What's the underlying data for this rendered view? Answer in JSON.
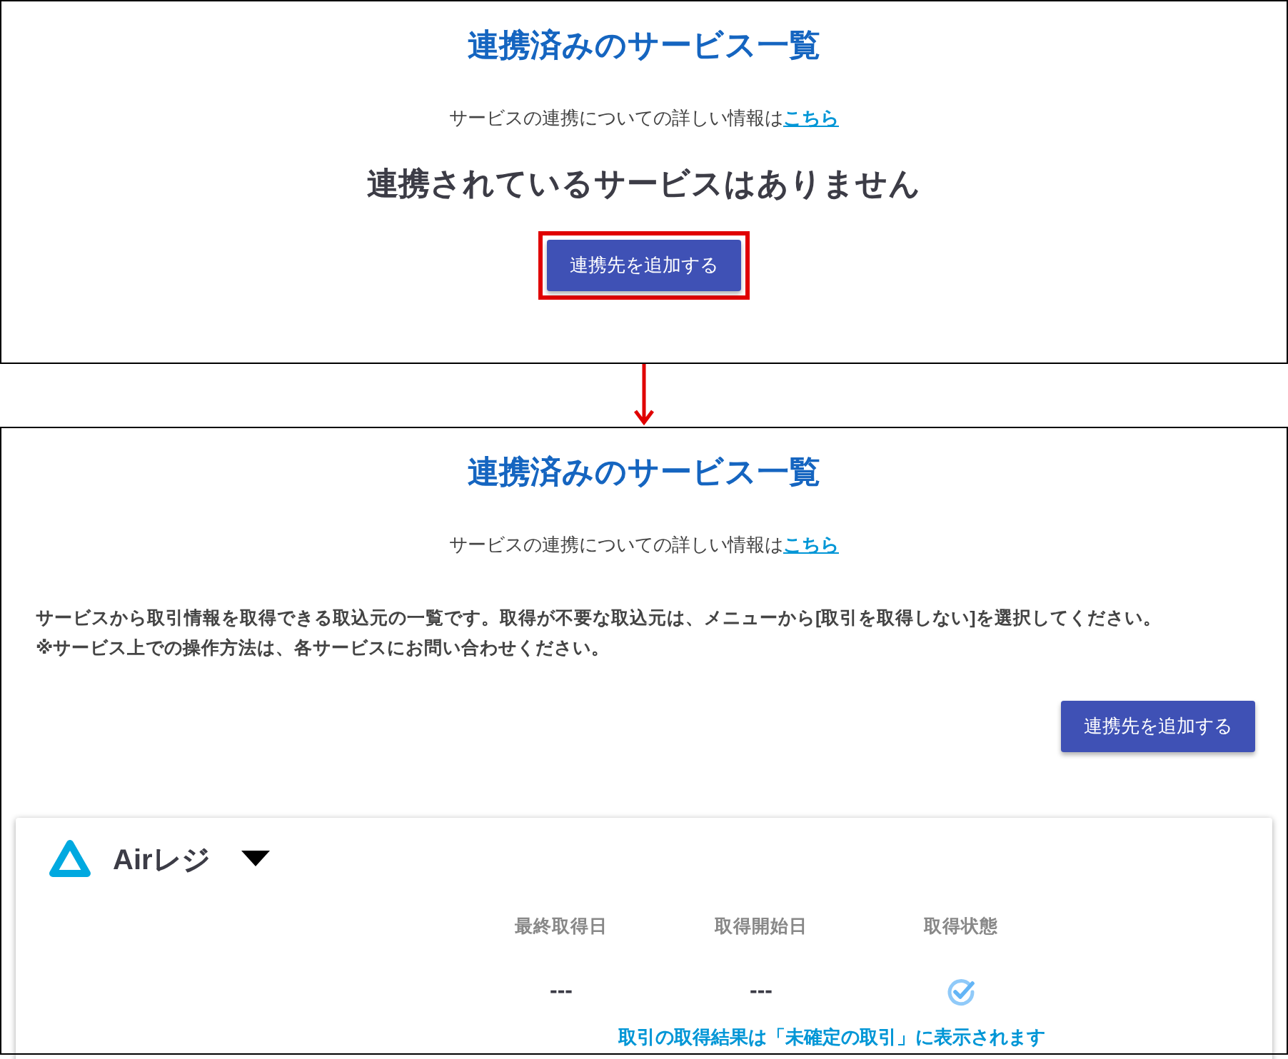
{
  "panels": [
    {
      "title": "連携済みのサービス一覧",
      "info": {
        "text": "サービスの連携についての詳しい情報は",
        "link": "こちら"
      },
      "empty_message": "連携されているサービスはありません",
      "add_button": {
        "label": "連携先を追加する",
        "highlighted": true
      }
    },
    {
      "title": "連携済みのサービス一覧",
      "info": {
        "text": "サービスの連携についての詳しい情報は",
        "link": "こちら"
      },
      "description": [
        "サービスから取引情報を取得できる取込元の一覧です。取得が不要な取込元は、メニューから[取引を取得しない]を選択してください。",
        "※サービス上での操作方法は、各サービスにお問い合わせください。"
      ],
      "add_button": {
        "label": "連携先を追加する",
        "highlighted": false
      },
      "services": [
        {
          "name": "Airレジ",
          "columns": [
            {
              "kind": "text",
              "header": "最終取得日",
              "value": "---"
            },
            {
              "kind": "text",
              "header": "取得開始日",
              "value": "---"
            },
            {
              "kind": "status",
              "header": "取得状態"
            }
          ],
          "note": "取引の取得結果は「未確定の取引」に表示されます"
        }
      ]
    }
  ]
}
